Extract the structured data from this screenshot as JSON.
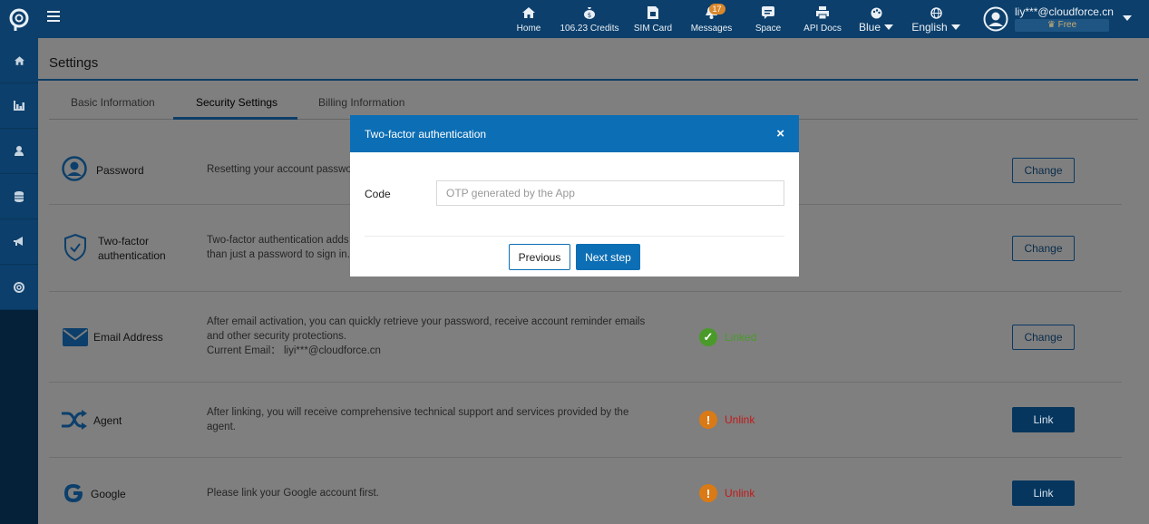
{
  "colors": {
    "brand_header": "#0c3f6b",
    "modal_accent": "#0c6eb4",
    "linked": "#4a9a2a",
    "unlink": "#c21a1a",
    "warning": "#d97a16"
  },
  "topnav": {
    "items": [
      {
        "label": "Home",
        "icon": "home-icon"
      },
      {
        "label": "106.23 Credits",
        "icon": "coin-bag-icon"
      },
      {
        "label": "SIM Card",
        "icon": "sim-card-icon"
      },
      {
        "label": "Messages",
        "icon": "bell-icon",
        "badge": "17"
      },
      {
        "label": "Space",
        "icon": "chat-icon"
      },
      {
        "label": "API Docs",
        "icon": "printer-icon"
      }
    ],
    "theme": {
      "label": "Blue",
      "icon": "palette-icon"
    },
    "language": {
      "label": "English",
      "icon": "globe-icon"
    },
    "user": {
      "email": "liy***@cloudforce.cn",
      "plan": "Free"
    }
  },
  "sidebar": {
    "items": [
      {
        "icon": "home-icon"
      },
      {
        "icon": "bar-chart-icon"
      },
      {
        "icon": "user-icon"
      },
      {
        "icon": "database-icon"
      },
      {
        "icon": "megaphone-icon"
      },
      {
        "icon": "lifebuoy-icon"
      }
    ]
  },
  "page": {
    "title": "Settings",
    "tabs": [
      "Basic Information",
      "Security Settings",
      "Billing Information"
    ]
  },
  "rows": {
    "password": {
      "label": "Password",
      "desc": "Resetting your account passwo",
      "button": "Change"
    },
    "twofa": {
      "label_1": "Two-factor",
      "label_2": "authentication",
      "desc_1": "Two-factor authentication adds",
      "desc_2": "than just a password to sign in.",
      "button": "Change"
    },
    "email": {
      "label": "Email Address",
      "desc_1": "After email activation, you can quickly retrieve your password, receive account reminder emails",
      "desc_2": "and other security protections.",
      "desc_3": "Current Email： liyi***@cloudforce.cn",
      "status": "Linked",
      "button": "Change"
    },
    "agent": {
      "label": "Agent",
      "desc_1": "After linking, you will receive comprehensive technical support and services provided by the",
      "desc_2": "agent.",
      "status": "Unlink",
      "button": "Link"
    },
    "google": {
      "label": "Google",
      "desc": "Please link your Google account first.",
      "status": "Unlink",
      "button": "Link"
    }
  },
  "modal": {
    "title": "Two-factor authentication",
    "close": "×",
    "code_label": "Code",
    "code_value": "",
    "code_placeholder": "OTP generated by the App",
    "previous": "Previous",
    "next": "Next step"
  }
}
